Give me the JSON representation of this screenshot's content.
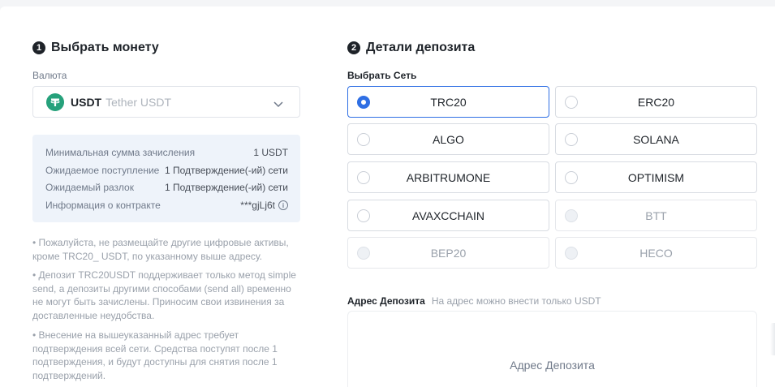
{
  "left": {
    "step_num": "1",
    "title": "Выбрать монету",
    "currency_label": "Валюта",
    "coin": {
      "code": "USDT",
      "name": "Tether USDT",
      "icon": "tether-icon",
      "color": "#26a17b"
    },
    "info": [
      {
        "label": "Минимальная сумма зачисления",
        "value": "1 USDT"
      },
      {
        "label": "Ожидаемое поступление",
        "value": "1 Подтверждение(-ий) сети"
      },
      {
        "label": "Ожидаемый разлок",
        "value": "1 Подтверждение(-ий) сети"
      },
      {
        "label": "Информация о контракте",
        "value": "***gjLj6t"
      }
    ],
    "notes": [
      "• Пожалуйста, не размещайте другие цифровые активы, кроме TRC20_ USDT, по указанному выше адресу.",
      "• Депозит TRC20USDT поддерживает только метод simple send, а депозиты другими способами (send all) временно не могут быть зачислены. Приносим свои извинения за доставленные неудобства.",
      "• Внесение на вышеуказанный адрес требует подтверждения всей сети. Средства поступят после 1 подтверждения, и будут доступны для снятия после 1 подтверждений."
    ]
  },
  "right": {
    "step_num": "2",
    "title": "Детали депозита",
    "network_label": "Выбрать Сеть",
    "networks": [
      {
        "name": "TRC20",
        "state": "selected"
      },
      {
        "name": "ERC20",
        "state": "normal"
      },
      {
        "name": "ALGO",
        "state": "normal"
      },
      {
        "name": "SOLANA",
        "state": "normal"
      },
      {
        "name": "ARBITRUMONE",
        "state": "normal"
      },
      {
        "name": "OPTIMISM",
        "state": "normal"
      },
      {
        "name": "AVAXCCHAIN",
        "state": "normal"
      },
      {
        "name": "BTT",
        "state": "disabled"
      },
      {
        "name": "BEP20",
        "state": "disabled"
      },
      {
        "name": "HECO",
        "state": "disabled"
      }
    ],
    "address_label": "Адрес Депозита",
    "address_hint": "На адрес можно внести только USDT",
    "address_placeholder": "Адрес Депозита"
  },
  "colors": {
    "accent": "#2f6fe4",
    "tether": "#26a17b"
  }
}
